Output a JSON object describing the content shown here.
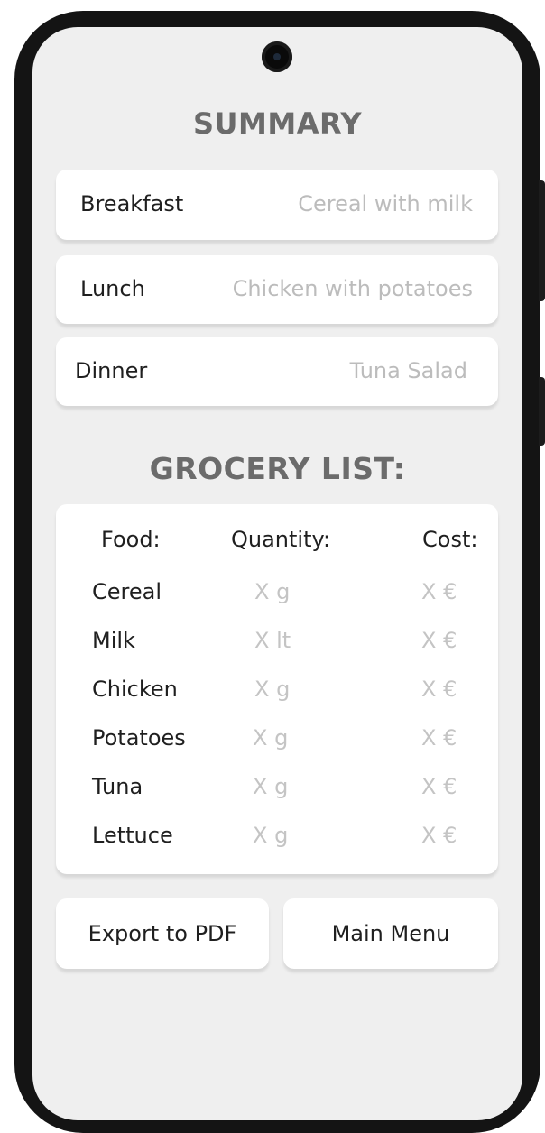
{
  "summary": {
    "title": "SUMMARY",
    "meals": [
      {
        "label": "Breakfast",
        "value": "Cereal with milk"
      },
      {
        "label": "Lunch",
        "value": "Chicken with potatoes"
      },
      {
        "label": "Dinner",
        "value": "Tuna Salad"
      }
    ]
  },
  "grocery": {
    "title": "GROCERY LIST:",
    "headers": {
      "food": "Food:",
      "quantity": "Quantity:",
      "cost": "Cost:"
    },
    "rows": [
      {
        "food": "Cereal",
        "quantity": "X g",
        "cost": "X €"
      },
      {
        "food": "Milk",
        "quantity": "X lt",
        "cost": "X €"
      },
      {
        "food": "Chicken",
        "quantity": "X g",
        "cost": "X €"
      },
      {
        "food": "Potatoes",
        "quantity": "X g",
        "cost": "X €"
      },
      {
        "food": "Tuna",
        "quantity": "X g",
        "cost": "X €"
      },
      {
        "food": "Lettuce",
        "quantity": "X g",
        "cost": "X €"
      }
    ]
  },
  "actions": {
    "export_label": "Export to PDF",
    "menu_label": "Main Menu"
  }
}
